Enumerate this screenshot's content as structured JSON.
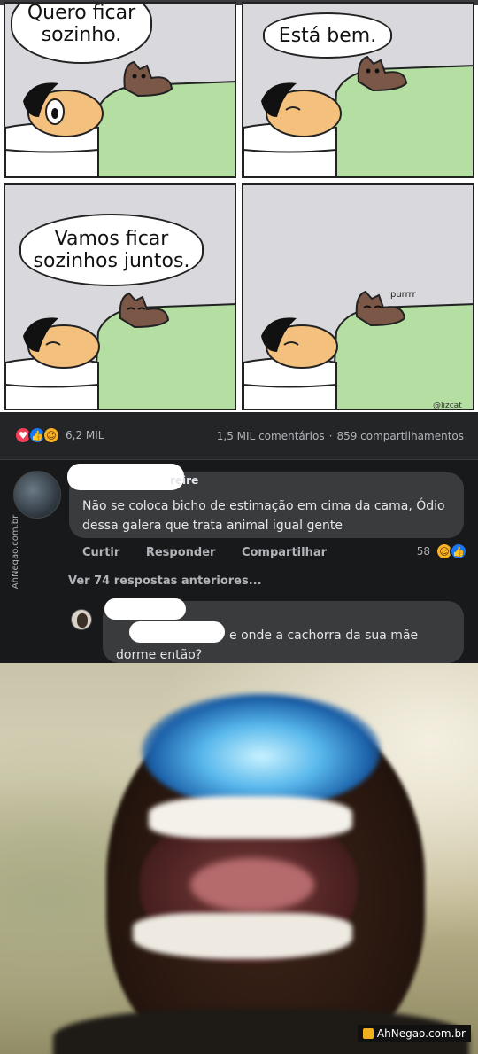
{
  "comic": {
    "panel1_speech": "Quero ficar sozinho.",
    "panel2_speech": "Está bem.",
    "panel3_speech": "Vamos ficar sozinhos juntos.",
    "panel4_sound": "purrrr",
    "artist_signature": "@lizcat"
  },
  "post": {
    "reaction_count": "6,2 MIL",
    "comments_count": "1,5 MIL comentários",
    "separator": "·",
    "shares_count": "859 compartilhamentos",
    "reaction_icons": [
      "love-icon",
      "like-icon",
      "haha-icon"
    ]
  },
  "comment1": {
    "author_name_partial": "reire",
    "text": "Não se coloca bicho de estimação em cima da cama, Ódio dessa galera que trata animal igual gente",
    "actions": {
      "like": "Curtir",
      "reply": "Responder",
      "share": "Compartilhar"
    },
    "like_count": "58",
    "view_previous": "Ver 74 respostas anteriores..."
  },
  "comment2": {
    "text_line1": "e onde a cachorra da sua mãe",
    "text_line2": "dorme então?"
  },
  "watermarks": {
    "side": "AhNegao.com.br",
    "bottom": "AhNegao.com.br"
  },
  "colors": {
    "fb_background": "#18191a",
    "bubble": "#3a3b3c",
    "panel_background": "#d9d8dd",
    "blanket": "#b4dea2",
    "cat": "#7b5748"
  }
}
